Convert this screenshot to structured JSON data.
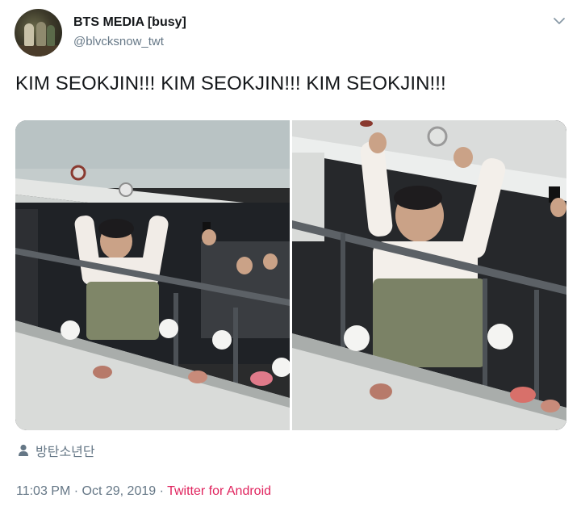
{
  "tweet": {
    "author": {
      "display_name": "BTS MEDIA [busy]",
      "handle": "@blvcksnow_twt"
    },
    "text": "KIM SEOKJIN!!! KIM SEOKJIN!!! KIM SEOKJIN!!!",
    "media": [
      {
        "kind": "photo"
      },
      {
        "kind": "photo"
      }
    ],
    "location": {
      "icon": "person-icon",
      "label": "방탄소년단"
    },
    "meta": {
      "time": "11:03 PM",
      "separator1": " · ",
      "date": "Oct 29, 2019",
      "separator2": " · ",
      "source": "Twitter for Android"
    }
  },
  "icons": {
    "menu": "chevron-down-icon"
  },
  "colors": {
    "text": "#14171a",
    "secondary": "#657786",
    "source_link": "#e0245e",
    "background": "#ffffff"
  }
}
